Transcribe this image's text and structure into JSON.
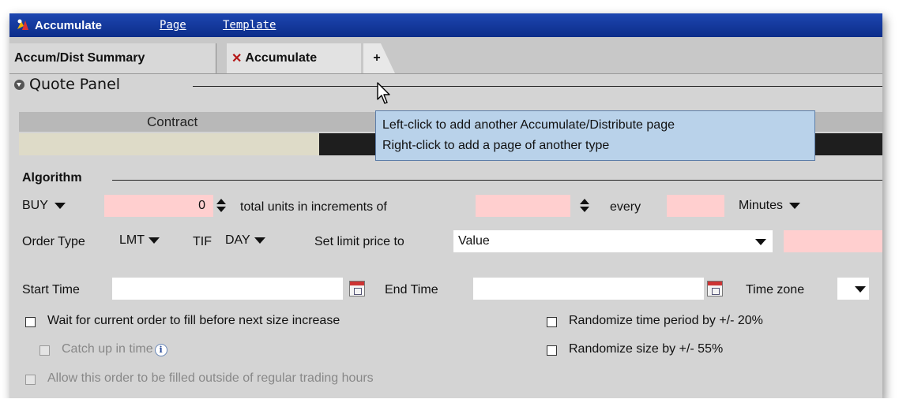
{
  "titlebar": {
    "app_title": "Accumulate",
    "menu": [
      "Page",
      "Template"
    ]
  },
  "tabs": {
    "summary": "Accum/Dist Summary",
    "accumulate": "Accumulate",
    "add": "+"
  },
  "quote_panel": {
    "title": "Quote Panel",
    "contract_header": "Contract"
  },
  "tooltip": {
    "line1": "Left-click to add another Accumulate/Distribute page",
    "line2": "Right-click to add a page of another type"
  },
  "algorithm": {
    "title": "Algorithm",
    "side": "BUY",
    "quantity": "0",
    "total_units_label": "total units in increments of",
    "increment_value": "",
    "every_label": "every",
    "every_value": "",
    "unit": "Minutes",
    "order_type_label": "Order Type",
    "order_type": "LMT",
    "tif_label": "TIF",
    "tif": "DAY",
    "limit_price_label": "Set limit price to",
    "limit_price_mode": "Value",
    "limit_price_value": "",
    "start_time_label": "Start Time",
    "start_time_value": "",
    "end_time_label": "End Time",
    "end_time_value": "",
    "time_zone_label": "Time zone",
    "time_zone_value": "",
    "wait_label": "Wait for current order to fill before next size increase",
    "catch_up_label": "Catch up in time",
    "outside_rth_label": "Allow this order to be filled outside of regular trading hours",
    "randomize_time_label": "Randomize time period by +/- 20%",
    "randomize_size_label": "Randomize size by +/- 55%"
  },
  "colors": {
    "titlebar": "#0c2d8a",
    "window_bg": "#d4d4d4",
    "input_pink": "#ffcfcf",
    "tooltip_bg": "#b9d2ea",
    "contract_cell": "#dedbc8"
  }
}
